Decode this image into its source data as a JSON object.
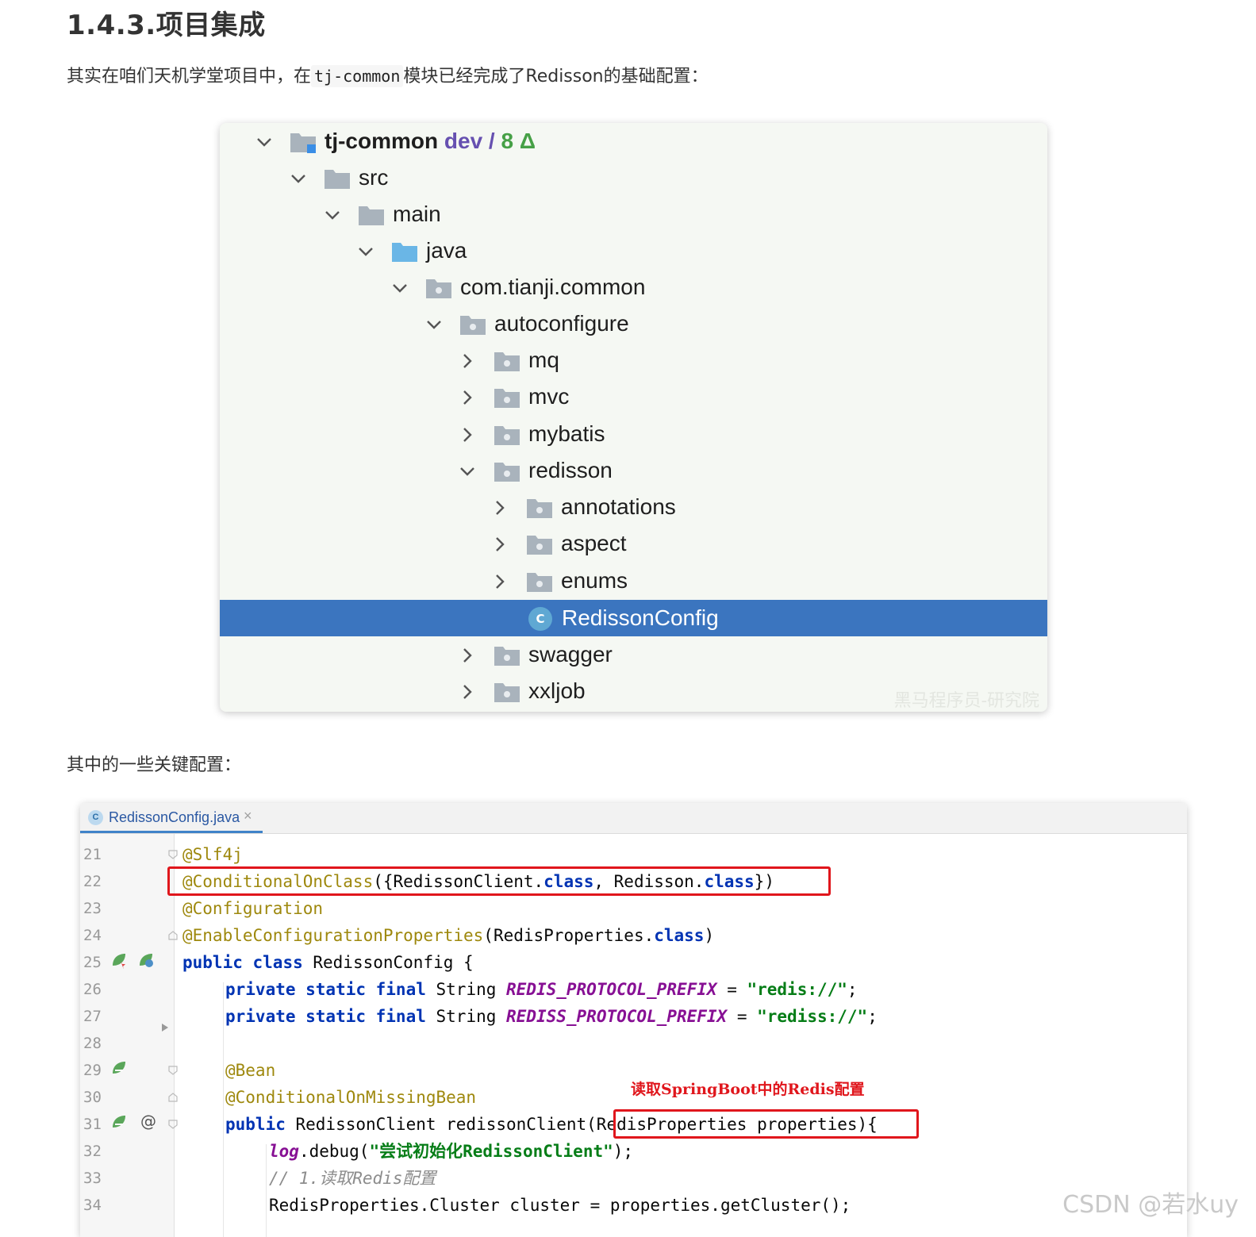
{
  "heading": "1.4.3.项目集成",
  "intro": {
    "before": "其实在咱们天机学堂项目中，在",
    "code": "tj-common",
    "after": "模块已经完成了Redisson的基础配置："
  },
  "tree": {
    "root": {
      "label": "tj-common",
      "branch": "dev",
      "slash": " / ",
      "count": "8 Δ"
    },
    "items": [
      {
        "label": "src"
      },
      {
        "label": "main"
      },
      {
        "label": "java"
      },
      {
        "label": "com.tianji.common"
      },
      {
        "label": "autoconfigure"
      },
      {
        "label": "mq"
      },
      {
        "label": "mvc"
      },
      {
        "label": "mybatis"
      },
      {
        "label": "redisson"
      },
      {
        "label": "annotations"
      },
      {
        "label": "aspect"
      },
      {
        "label": "enums"
      },
      {
        "label": "RedissonConfig",
        "icon_letter": "C"
      },
      {
        "label": "swagger"
      },
      {
        "label": "xxljob"
      }
    ],
    "watermark": "黑马程序员-研究院"
  },
  "section2": "其中的一些关键配置：",
  "editor": {
    "tab": {
      "label": "RedissonConfig.java",
      "icon_letter": "C",
      "close": "×"
    },
    "line_numbers": [
      "21",
      "22",
      "23",
      "24",
      "25",
      "26",
      "27",
      "28",
      "29",
      "30",
      "31",
      "32",
      "33",
      "34"
    ],
    "lines": {
      "l21": {
        "a": "@Slf4j"
      },
      "l22": {
        "a": "@ConditionalOnClass",
        "b": "({RedissonClient.",
        "c": "class",
        "d": ", Redisson.",
        "e": "class",
        "f": "})"
      },
      "l23": {
        "a": "@Configuration"
      },
      "l24": {
        "a": "@EnableConfigurationProperties",
        "b": "(RedisProperties.",
        "c": "class",
        "d": ")"
      },
      "l25": {
        "a": "public",
        "b": " ",
        "c": "class",
        "d": " RedissonConfig {"
      },
      "l26": {
        "a": "private static final",
        "b": " String ",
        "c": "REDIS_PROTOCOL_PREFIX",
        "d": " = ",
        "e": "\"redis://\"",
        "f": ";"
      },
      "l27": {
        "a": "private static final",
        "b": " String ",
        "c": "REDISS_PROTOCOL_PREFIX",
        "d": " = ",
        "e": "\"rediss://\"",
        "f": ";"
      },
      "l29": {
        "a": "@Bean"
      },
      "l30": {
        "a": "@ConditionalOnMissingBean"
      },
      "l31": {
        "a": "public",
        "b": " RedissonClient redissonClient",
        "c": "(RedisProperties properties)",
        "d": "{"
      },
      "l32": {
        "a": "log",
        "b": ".debug(",
        "c": "\"尝试初始化RedissonClient\"",
        "d": ");"
      },
      "l33": {
        "a": "// 1.读取Redis配置"
      },
      "l34": {
        "a": "RedisProperties.Cluster cluster = properties.getCluster();"
      }
    },
    "annotation_note": "读取SpringBoot中的Redis配置",
    "gutter_at": "@"
  },
  "watermark": "CSDN @若水uy",
  "colors": {
    "selection": "#3b75bf",
    "keyword": "#0033b3",
    "annotation": "#9e880d",
    "constant": "#871094",
    "string": "#067d17",
    "highlight_box": "#e0161c"
  }
}
